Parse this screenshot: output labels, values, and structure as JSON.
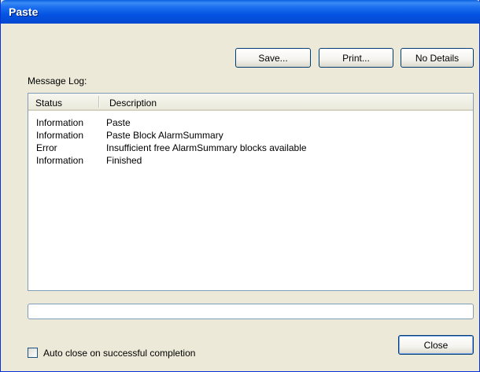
{
  "window": {
    "title": "Paste",
    "colors": {
      "titlebar": "#0554e3",
      "dialog_bg": "#ece9d8",
      "button_border": "#003c74"
    }
  },
  "toolbar": {
    "save_label": "Save...",
    "print_label": "Print...",
    "details_label": "No Details"
  },
  "log": {
    "label": "Message Log:",
    "columns": [
      "Status",
      "Description"
    ],
    "rows": [
      {
        "status": "Information",
        "description": "Paste"
      },
      {
        "status": "Information",
        "description": "Paste Block AlarmSummary"
      },
      {
        "status": "Error",
        "description": "Insufficient free AlarmSummary blocks available"
      },
      {
        "status": "Information",
        "description": "Finished"
      }
    ]
  },
  "progress": {
    "value": 0
  },
  "options": {
    "auto_close_label": "Auto close on successful completion",
    "auto_close_checked": false
  },
  "footer": {
    "close_label": "Close"
  }
}
